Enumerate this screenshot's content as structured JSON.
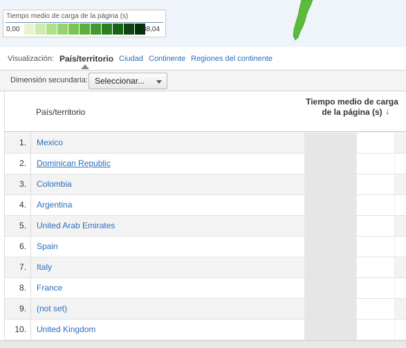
{
  "legend": {
    "title": "Tiempo medio de carga de la página (s)",
    "min": "0,00",
    "max": "38,04",
    "scale_colors": [
      "#e6f5d0",
      "#cdebae",
      "#b2df8a",
      "#96d26d",
      "#79c552",
      "#5cae3e",
      "#41992f",
      "#2b7f22",
      "#1a6217",
      "#0d4410",
      "#063008"
    ]
  },
  "map": {
    "ocean_color": "#eef4f9",
    "land_color": "#5dbb3a"
  },
  "visualization": {
    "label": "Visualización:",
    "active": "País/territorio",
    "links": [
      "Ciudad",
      "Continente",
      "Regiones del continente"
    ]
  },
  "secondary_dimension": {
    "label": "Dimensión secundaria:",
    "select_value": "Seleccionar..."
  },
  "table": {
    "header_country": "País/territorio",
    "header_metric": "Tiempo medio de carga de la página (s)",
    "sort_icon": "↓",
    "rows": [
      {
        "rank": "1.",
        "country": "Mexico"
      },
      {
        "rank": "2.",
        "country": "Dominican Republic"
      },
      {
        "rank": "3.",
        "country": "Colombia"
      },
      {
        "rank": "4.",
        "country": "Argentina"
      },
      {
        "rank": "5.",
        "country": "United Arab Emirates"
      },
      {
        "rank": "6.",
        "country": "Spain"
      },
      {
        "rank": "7.",
        "country": "Italy"
      },
      {
        "rank": "8.",
        "country": "France"
      },
      {
        "rank": "9.",
        "country": "(not set)"
      },
      {
        "rank": "10.",
        "country": "United Kingdom"
      }
    ]
  }
}
